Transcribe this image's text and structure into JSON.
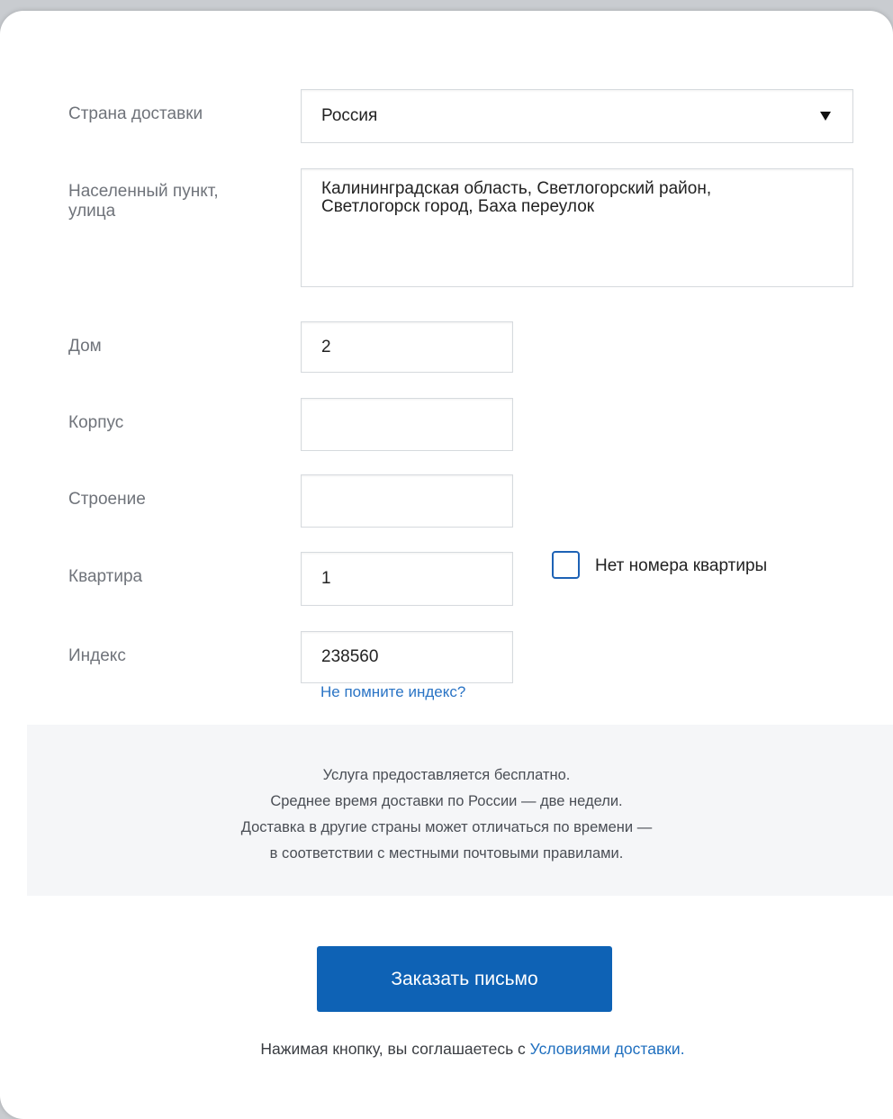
{
  "form": {
    "country": {
      "label": "Страна доставки",
      "value": "Россия"
    },
    "address": {
      "label": "Населенный пункт,\nулица",
      "value": "Калининградская область, Светлогорский район,\nСветлогорск город, Баха переулок"
    },
    "house": {
      "label": "Дом",
      "value": "2"
    },
    "building": {
      "label": "Корпус",
      "value": ""
    },
    "structure": {
      "label": "Строение",
      "value": ""
    },
    "apartment": {
      "label": "Квартира",
      "value": "1",
      "no_apartment_label": "Нет номера квартиры",
      "no_apartment_checked": false
    },
    "index": {
      "label": "Индекс",
      "value": "238560",
      "help_link": "Не помните индекс?"
    }
  },
  "info": {
    "lines": [
      "Услуга предоставляется бесплатно.",
      "Среднее время доставки по России — две недели.",
      "Доставка в другие страны может отличаться по времени —",
      "в соответствии с местными  почтовыми правилами."
    ]
  },
  "submit": {
    "label": "Заказать письмо"
  },
  "terms": {
    "prefix": "Нажимая кнопку, вы соглашаетесь с ",
    "link": "Условиями доставки",
    "suffix": "."
  },
  "colors": {
    "accent": "#0e62b5",
    "link": "#2a74c5"
  },
  "icons": {
    "select_arrow": "triangle-down-icon"
  }
}
